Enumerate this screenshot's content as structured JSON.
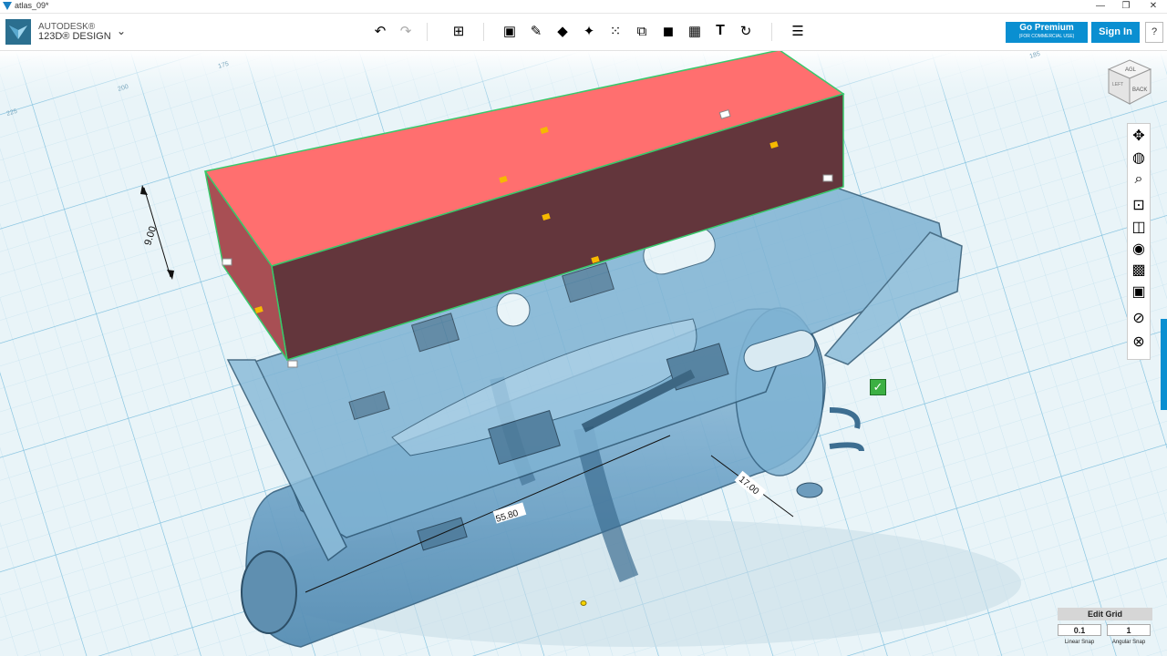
{
  "window": {
    "title": "atlas_09*",
    "controls": {
      "minimize": "—",
      "maximize": "❐",
      "close": "✕"
    }
  },
  "brand": {
    "line1": "AUTODESK®",
    "line2": "123D® DESIGN",
    "menu_glyph": "⌄",
    "icon": "123d-logo-icon"
  },
  "toolbar": {
    "tools": [
      {
        "name": "undo-button",
        "glyph": "↶"
      },
      {
        "name": "redo-button",
        "glyph": "↷"
      },
      {
        "name": "transform-button",
        "glyph": "⊞"
      },
      {
        "name": "primitives-button",
        "glyph": "▣"
      },
      {
        "name": "sketch-button",
        "glyph": "✎"
      },
      {
        "name": "construct-button",
        "glyph": "◆"
      },
      {
        "name": "modify-button",
        "glyph": "✦"
      },
      {
        "name": "pattern-button",
        "glyph": "⁙"
      },
      {
        "name": "grouping-button",
        "glyph": "⧉"
      },
      {
        "name": "combine-button",
        "glyph": "◼"
      },
      {
        "name": "measure-button",
        "glyph": "▦"
      },
      {
        "name": "text-button",
        "glyph": "T"
      },
      {
        "name": "snap-button",
        "glyph": "↻"
      },
      {
        "name": "material-button",
        "glyph": "☰"
      }
    ]
  },
  "account": {
    "premium_label": "Go Premium",
    "premium_sub": "(FOR COMMERCIAL USE)",
    "signin_label": "Sign In",
    "help_label": "?"
  },
  "viewcube": {
    "face_top": "AGL",
    "face_front": "BACK",
    "face_side": "LEFT"
  },
  "navigation": [
    {
      "name": "pan-icon",
      "glyph": "✥"
    },
    {
      "name": "orbit-icon",
      "glyph": "◍"
    },
    {
      "name": "zoom-icon",
      "glyph": "⌕"
    },
    {
      "name": "fit-icon",
      "glyph": "⊡"
    },
    {
      "name": "views-icon",
      "glyph": "◫"
    },
    {
      "name": "visibility-icon",
      "glyph": "◉"
    },
    {
      "name": "materials-outlines-icon",
      "glyph": "▩"
    },
    {
      "name": "screenshot-icon",
      "glyph": "▣"
    },
    {
      "name": "hide-sketches-icon",
      "glyph": "⊘"
    },
    {
      "name": "hide-meshes-icon",
      "glyph": "⊗"
    }
  ],
  "grid_labels": [
    "175",
    "200",
    "225",
    "185"
  ],
  "dimensions": {
    "height": "9.00",
    "length": "55.80",
    "width": "17.00"
  },
  "edit_grid": {
    "title": "Edit Grid",
    "linear_value": "0.1",
    "angular_value": "1",
    "linear_label": "Linear Snap",
    "angular_label": "Angular Snap"
  },
  "colors": {
    "accent": "#0a8fd1",
    "selection_red": "#ff6f6f",
    "part_blue": "#7fb3d3",
    "grid_bg": "#e9f4f8",
    "confirm_green": "#3cb043"
  }
}
